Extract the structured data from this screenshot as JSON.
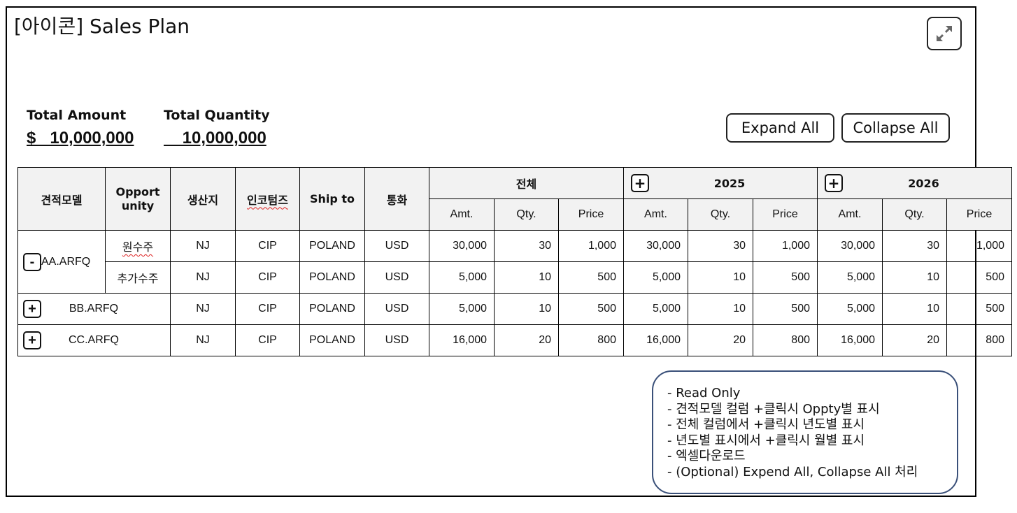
{
  "title": "[아이콘] Sales Plan",
  "totals": {
    "amount_label": "Total Amount",
    "amount_value": "$   10,000,000",
    "quantity_label": "Total Quantity",
    "quantity_value": "    10,000,000"
  },
  "buttons": {
    "expand_all": "Expand All",
    "collapse_all": "Collapse All"
  },
  "icons": {
    "fullscreen": "expand-arrows-icon",
    "plus": "+",
    "minus": "-"
  },
  "table": {
    "headers": {
      "model": "견적모델",
      "opportunity": "Opport unity",
      "origin": "생산지",
      "incoterms": "인코텀즈",
      "ship_to": "Ship to",
      "currency": "통화",
      "total": "전체",
      "year1": "2025",
      "year2": "2026",
      "amt": "Amt.",
      "qty": "Qty.",
      "price": "Price"
    },
    "group_aa": {
      "model": "AA.ARFQ",
      "rows": [
        {
          "oppty": "원수주",
          "origin": "NJ",
          "incoterms": "CIP",
          "ship_to": "POLAND",
          "currency": "USD",
          "t_amt": "30,000",
          "t_qty": "30",
          "t_price": "1,000",
          "y1_amt": "30,000",
          "y1_qty": "30",
          "y1_price": "1,000",
          "y2_amt": "30,000",
          "y2_qty": "30",
          "y2_price": "1,000"
        },
        {
          "oppty": "추가수주",
          "origin": "NJ",
          "incoterms": "CIP",
          "ship_to": "POLAND",
          "currency": "USD",
          "t_amt": "5,000",
          "t_qty": "10",
          "t_price": "500",
          "y1_amt": "5,000",
          "y1_qty": "10",
          "y1_price": "500",
          "y2_amt": "5,000",
          "y2_qty": "10",
          "y2_price": "500"
        }
      ]
    },
    "collapsed_rows": [
      {
        "model": "BB.ARFQ",
        "origin": "NJ",
        "incoterms": "CIP",
        "ship_to": "POLAND",
        "currency": "USD",
        "t_amt": "5,000",
        "t_qty": "10",
        "t_price": "500",
        "y1_amt": "5,000",
        "y1_qty": "10",
        "y1_price": "500",
        "y2_amt": "5,000",
        "y2_qty": "10",
        "y2_price": "500"
      },
      {
        "model": "CC.ARFQ",
        "origin": "NJ",
        "incoterms": "CIP",
        "ship_to": "POLAND",
        "currency": "USD",
        "t_amt": "16,000",
        "t_qty": "20",
        "t_price": "800",
        "y1_amt": "16,000",
        "y1_qty": "20",
        "y1_price": "800",
        "y2_amt": "16,000",
        "y2_qty": "20",
        "y2_price": "800"
      }
    ]
  },
  "notes": [
    "- Read Only",
    "- 견적모델 컬럼 +클릭시 Oppty별 표시",
    "- 전체 컬럼에서 +클릭시 년도별 표시",
    "- 년도별 표시에서 +클릭시 월별 표시",
    "- 엑셀다운로드",
    "- (Optional) Expend All, Collapse All 처리"
  ]
}
